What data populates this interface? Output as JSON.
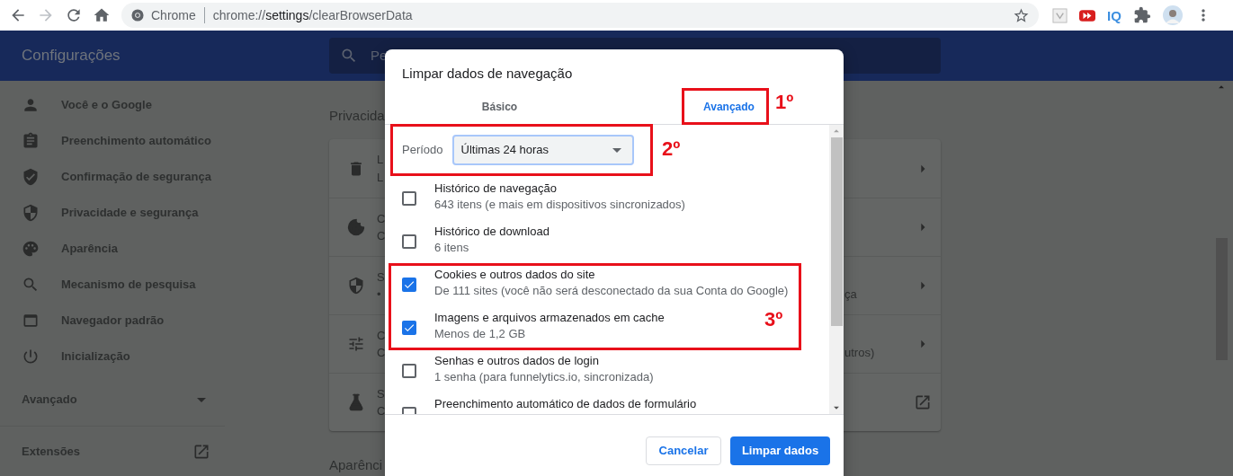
{
  "browser": {
    "forward_disabled": true,
    "site_label": "Chrome",
    "url": {
      "scheme": "chrome://",
      "host": "settings",
      "path": "/clearBrowserData"
    },
    "iq_logo": "IQ"
  },
  "header": {
    "title": "Configurações",
    "search_placeholder": "Pe"
  },
  "sidebar": {
    "items": [
      {
        "label": "Você e o Google"
      },
      {
        "label": "Preenchimento automático"
      },
      {
        "label": "Confirmação de segurança"
      },
      {
        "label": "Privacidade e segurança"
      },
      {
        "label": "Aparência"
      },
      {
        "label": "Mecanismo de pesquisa"
      },
      {
        "label": "Navegador padrão"
      },
      {
        "label": "Inicialização"
      }
    ],
    "advanced": {
      "label": "Avançado",
      "expanded": false
    },
    "extensions": "Extensões"
  },
  "main": {
    "section_title": "Privacida",
    "rows": [
      {
        "title": "L",
        "subtitle": "L"
      },
      {
        "title": "C",
        "subtitle": "C"
      },
      {
        "title": "S",
        "subtitle": "•",
        "subtitle_tail": "ça"
      },
      {
        "title": "C",
        "subtitle": "C",
        "subtitle_tail": "utros)"
      },
      {
        "title": "S",
        "subtitle": "C",
        "external": true
      }
    ],
    "next_section_title": "Aparênci"
  },
  "dialog": {
    "title": "Limpar dados de navegação",
    "tabs": [
      {
        "label": "Básico",
        "selected": false
      },
      {
        "label": "Avançado",
        "selected": true
      }
    ],
    "period": {
      "label": "Período",
      "value": "Últimas 24 horas"
    },
    "items": [
      {
        "title": "Histórico de navegação",
        "subtitle": "643 itens (e mais em dispositivos sincronizados)",
        "checked": false
      },
      {
        "title": "Histórico de download",
        "subtitle": "6 itens",
        "checked": false
      },
      {
        "title": "Cookies e outros dados do site",
        "subtitle": "De 111 sites (você não será desconectado da sua Conta do Google)",
        "checked": true
      },
      {
        "title": "Imagens e arquivos armazenados em cache",
        "subtitle": "Menos de 1,2 GB",
        "checked": true
      },
      {
        "title": "Senhas e outros dados de login",
        "subtitle": "1 senha (para funnelytics.io, sincronizada)",
        "checked": false
      },
      {
        "title": "Preenchimento automático de dados de formulário",
        "checked": false
      }
    ],
    "buttons": {
      "cancel": "Cancelar",
      "confirm": "Limpar dados"
    }
  },
  "annotations": [
    {
      "label": "1º"
    },
    {
      "label": "2º"
    },
    {
      "label": "3º"
    }
  ]
}
